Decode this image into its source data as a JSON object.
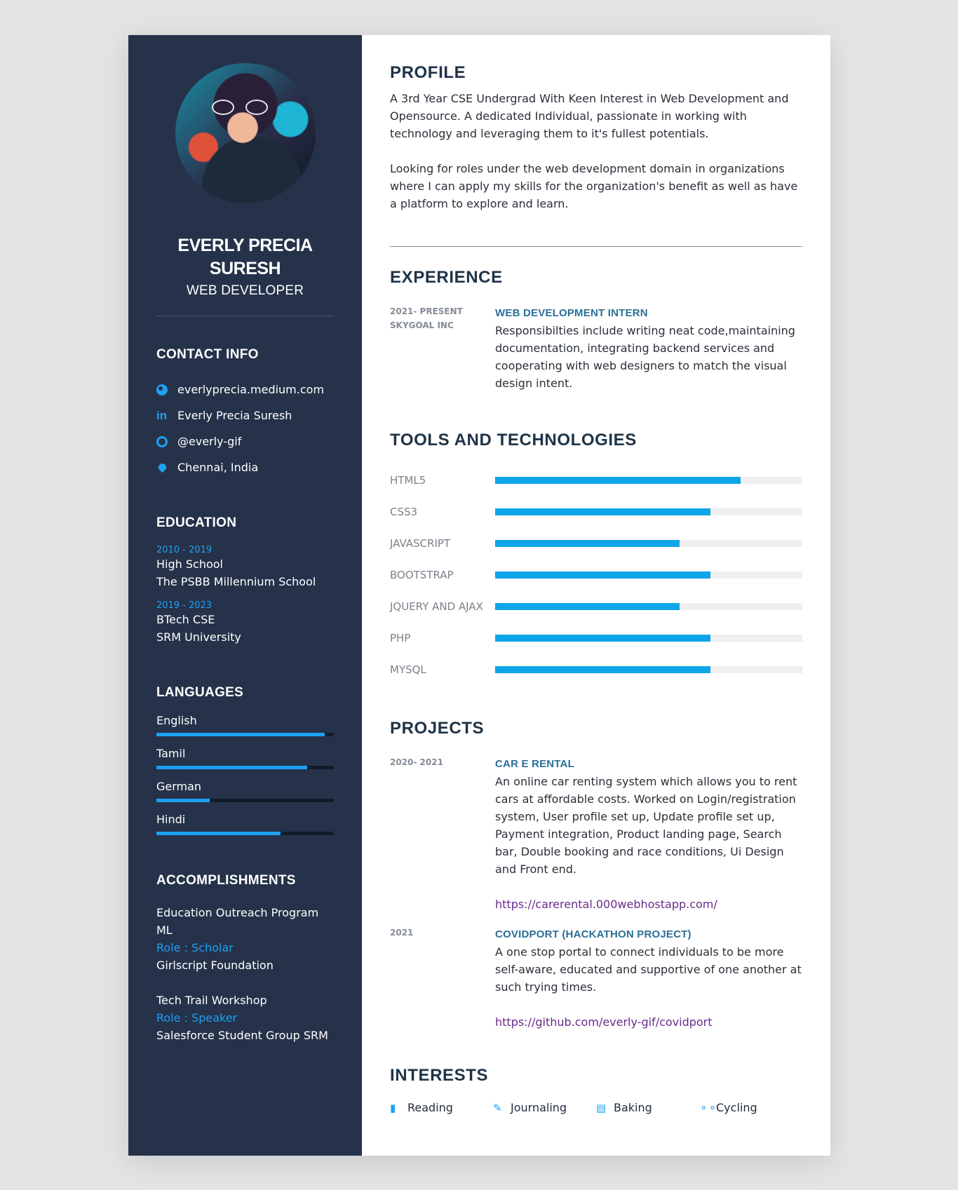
{
  "person": {
    "name": "EVERLY PRECIA SURESH",
    "name_line1": "EVERLY PRECIA",
    "name_line2": "SURESH",
    "role": "WEB DEVELOPER"
  },
  "contact": {
    "title": "CONTACT INFO",
    "items": [
      {
        "icon": "globe-icon",
        "text": "everlyprecia.medium.com"
      },
      {
        "icon": "linkedin-icon",
        "text": "Everly Precia Suresh"
      },
      {
        "icon": "github-icon",
        "text": "@everly-gif"
      },
      {
        "icon": "map-marker-icon",
        "text": "Chennai, India"
      }
    ]
  },
  "education": {
    "title": "EDUCATION",
    "items": [
      {
        "years": "2010 - 2019",
        "degree": "High School",
        "school": "The PSBB Millennium School"
      },
      {
        "years": "2019 - 2023",
        "degree": "BTech CSE",
        "school": "SRM University"
      }
    ]
  },
  "languages": {
    "title": "LANGUAGES",
    "items": [
      {
        "name": "English",
        "level": 0.95
      },
      {
        "name": "Tamil",
        "level": 0.85
      },
      {
        "name": "German",
        "level": 0.3
      },
      {
        "name": "Hindi",
        "level": 0.7
      }
    ]
  },
  "accomplishments": {
    "title": "ACCOMPLISHMENTS",
    "items": [
      {
        "line1": "Education Outreach Program",
        "line2": "ML",
        "role": "Role : Scholar",
        "org": "Girlscript Foundation"
      },
      {
        "line1": "Tech Trail Workshop",
        "line2": "",
        "role": "Role : Speaker",
        "org": "Salesforce Student Group SRM"
      }
    ]
  },
  "profile": {
    "title": "PROFILE",
    "p1": "A 3rd Year CSE Undergrad With Keen Interest in Web Development and Opensource. A dedicated Individual, passionate in working with technology and leveraging them to it's fullest potentials.",
    "p2": "Looking for roles under the web development domain in organizations where I can apply my skills for the organization's benefit as well as have a platform to explore and learn."
  },
  "experience": {
    "title": "EXPERIENCE",
    "items": [
      {
        "years": "2021- PRESENT",
        "company": "SKYGOAL INC",
        "position": "WEB DEVELOPMENT INTERN",
        "description": "Responsibilties include writing neat code,maintaining documentation, integrating backend services and cooperating with web designers to match the visual design intent."
      }
    ]
  },
  "tools": {
    "title": "TOOLS AND TECHNOLOGIES",
    "items": [
      {
        "name": "HTML5",
        "level": 0.8
      },
      {
        "name": "CSS3",
        "level": 0.7
      },
      {
        "name": "JAVASCRIPT",
        "level": 0.6
      },
      {
        "name": "BOOTSTRAP",
        "level": 0.7
      },
      {
        "name": "JQUERY AND AJAX",
        "level": 0.6
      },
      {
        "name": "PHP",
        "level": 0.7
      },
      {
        "name": "MYSQL",
        "level": 0.7
      }
    ]
  },
  "projects": {
    "title": "PROJECTS",
    "items": [
      {
        "years": "2020- 2021",
        "name": "CAR E RENTAL",
        "description": "An online car renting system which allows you to rent cars at affordable costs. Worked on Login/registration system, User profile set up, Update profile set up, Payment integration, Product landing page, Search bar, Double booking and race conditions, Ui Design and Front end.",
        "link": "https://carerental.000webhostapp.com/"
      },
      {
        "years": "2021",
        "name": "COVIDPORT (HACKATHON PROJECT)",
        "description": "A one stop portal to connect individuals to be more self-aware, educated and supportive of one another at such trying times.",
        "link": "https://github.com/everly-gif/covidport"
      }
    ]
  },
  "interests": {
    "title": "INTERESTS",
    "items": [
      {
        "icon": "book-icon",
        "label": "Reading"
      },
      {
        "icon": "pencil-icon",
        "label": "Journaling"
      },
      {
        "icon": "birthday-cake-icon",
        "label": "Baking"
      },
      {
        "icon": "bicycle-icon",
        "label": "Cycling"
      }
    ]
  },
  "colors": {
    "sidebar": "#25324a",
    "accent": "#1da1f2",
    "bar_fill": "#0ea5e9",
    "heading": "#1f3347",
    "subheading": "#2a6f9a",
    "link": "#6a2a8a"
  }
}
